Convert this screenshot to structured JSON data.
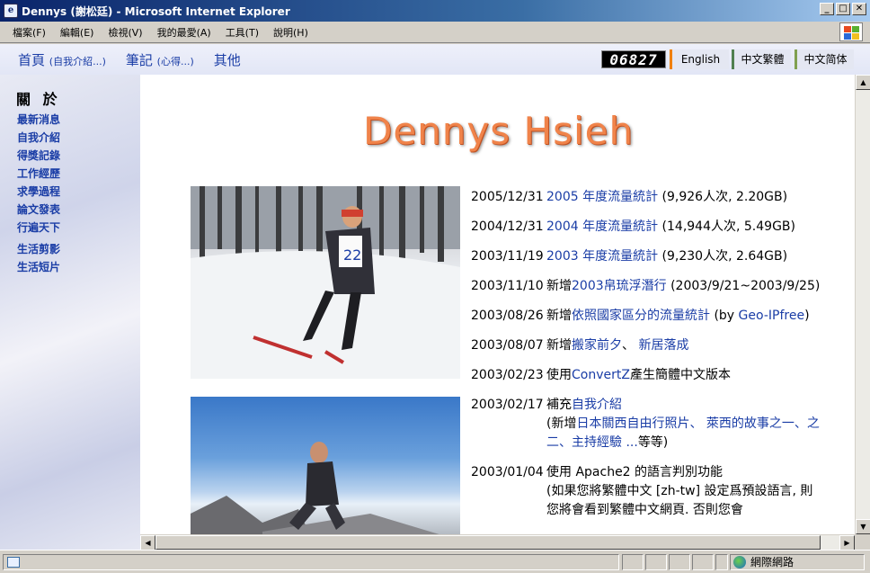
{
  "window": {
    "title": "Dennys (謝松廷) - Microsoft Internet Explorer",
    "buttons": [
      "_",
      "□",
      "✕"
    ]
  },
  "menu": [
    "檔案(F)",
    "編輯(E)",
    "檢視(V)",
    "我的最愛(A)",
    "工具(T)",
    "說明(H)"
  ],
  "topnav": {
    "home": "首頁",
    "home_sub": "(自我介紹...)",
    "notes": "筆記",
    "notes_sub": "(心得...)",
    "other": "其他",
    "counter": "06827",
    "lang_en": "English",
    "lang_zh_tw": "中文繁體",
    "lang_zh_cn": "中文简体"
  },
  "sidebar": {
    "heading": "關 於",
    "items": [
      "最新消息",
      "自我介紹",
      "得獎記錄",
      "工作經歷",
      "求學過程",
      "論文發表",
      "行遍天下",
      "生活剪影",
      "生活短片"
    ]
  },
  "content": {
    "logo": "Dennys Hsieh"
  },
  "news": [
    {
      "date": "2005/12/31",
      "link": "2005 年度流量統計",
      "text": " (9,926人次, 2.20GB)"
    },
    {
      "date": "2004/12/31",
      "link": "2004 年度流量統計",
      "text": " (14,944人次, 5.49GB)"
    },
    {
      "date": "2003/11/19",
      "link": "2003 年度流量統計",
      "text": " (9,230人次, 2.64GB)"
    },
    {
      "date": "2003/11/10",
      "pre": "新增",
      "link": "2003帛琉浮潛行",
      "text": " (2003/9/21~2003/9/25)"
    },
    {
      "date": "2003/08/26",
      "pre": "新增",
      "link": "依照國家區分的流量統計",
      "text": " (by ",
      "link2": "Geo-IPfree",
      "text2": ")"
    },
    {
      "date": "2003/08/07",
      "pre": "新增",
      "link": "搬家前夕",
      "text": "、 ",
      "link2": "新居落成",
      "text2": ""
    },
    {
      "date": "2003/02/23",
      "pre": "使用",
      "link": "ConvertZ",
      "text": "產生簡體中文版本"
    },
    {
      "date": "2003/02/17",
      "pre": "補充",
      "link": "自我介紹",
      "text": "",
      "line2_pre": "(新增",
      "line2_link": "日本關西自由行照片、 萊西的故事之一、之二、主持經驗 ...",
      "line2_text": "等等)"
    },
    {
      "date": "2003/01/04",
      "pre": "使用 Apache2 的語言判別功能",
      "line2": "(如果您將繁體中文 [zh-tw] 設定爲預設語言, 則您將會看到繁體中文網頁. 否則您會"
    }
  ],
  "status": {
    "zone": "網際網路"
  }
}
